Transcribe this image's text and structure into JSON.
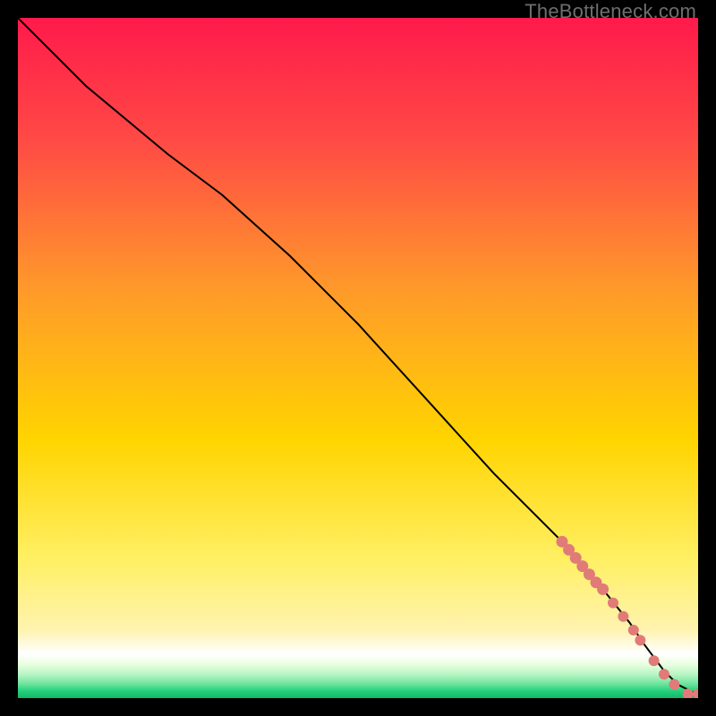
{
  "watermark": "TheBottleneck.com",
  "colors": {
    "bg_black": "#000000",
    "curve": "#000000",
    "marker_fill": "#e17b77",
    "marker_stroke": "#c96a66",
    "grad_top": "#ff1a4b",
    "grad_mid": "#ffd400",
    "grad_cream": "#fff3b0",
    "grad_pale": "#d9ffd0",
    "grad_green": "#21d07a"
  },
  "chart_data": {
    "type": "line",
    "title": "",
    "xlabel": "",
    "ylabel": "",
    "xlim": [
      0,
      100
    ],
    "ylim": [
      0,
      100
    ],
    "grid": false,
    "legend": false,
    "series": [
      {
        "name": "curve",
        "style": "line",
        "x": [
          0,
          10,
          22,
          30,
          40,
          50,
          60,
          70,
          80,
          86,
          90,
          92,
          95,
          97,
          100
        ],
        "values": [
          100,
          90,
          80,
          74,
          65,
          55,
          44,
          33,
          23,
          16,
          11,
          8,
          4,
          2,
          0.5
        ]
      },
      {
        "name": "markers-dense",
        "style": "scatter",
        "x": [
          80,
          81,
          82,
          83,
          84,
          85,
          86
        ],
        "values": [
          23.0,
          21.8,
          20.6,
          19.4,
          18.2,
          17.0,
          16.0
        ]
      },
      {
        "name": "markers-sparse",
        "style": "scatter",
        "x": [
          87.5,
          89.0,
          90.5,
          91.5,
          93.5,
          95.0,
          96.5
        ],
        "values": [
          14.0,
          12.0,
          10.0,
          8.5,
          5.5,
          3.5,
          2.0
        ]
      },
      {
        "name": "markers-tail",
        "style": "scatter",
        "x": [
          98.5,
          100
        ],
        "values": [
          0.6,
          0.6
        ]
      }
    ]
  }
}
